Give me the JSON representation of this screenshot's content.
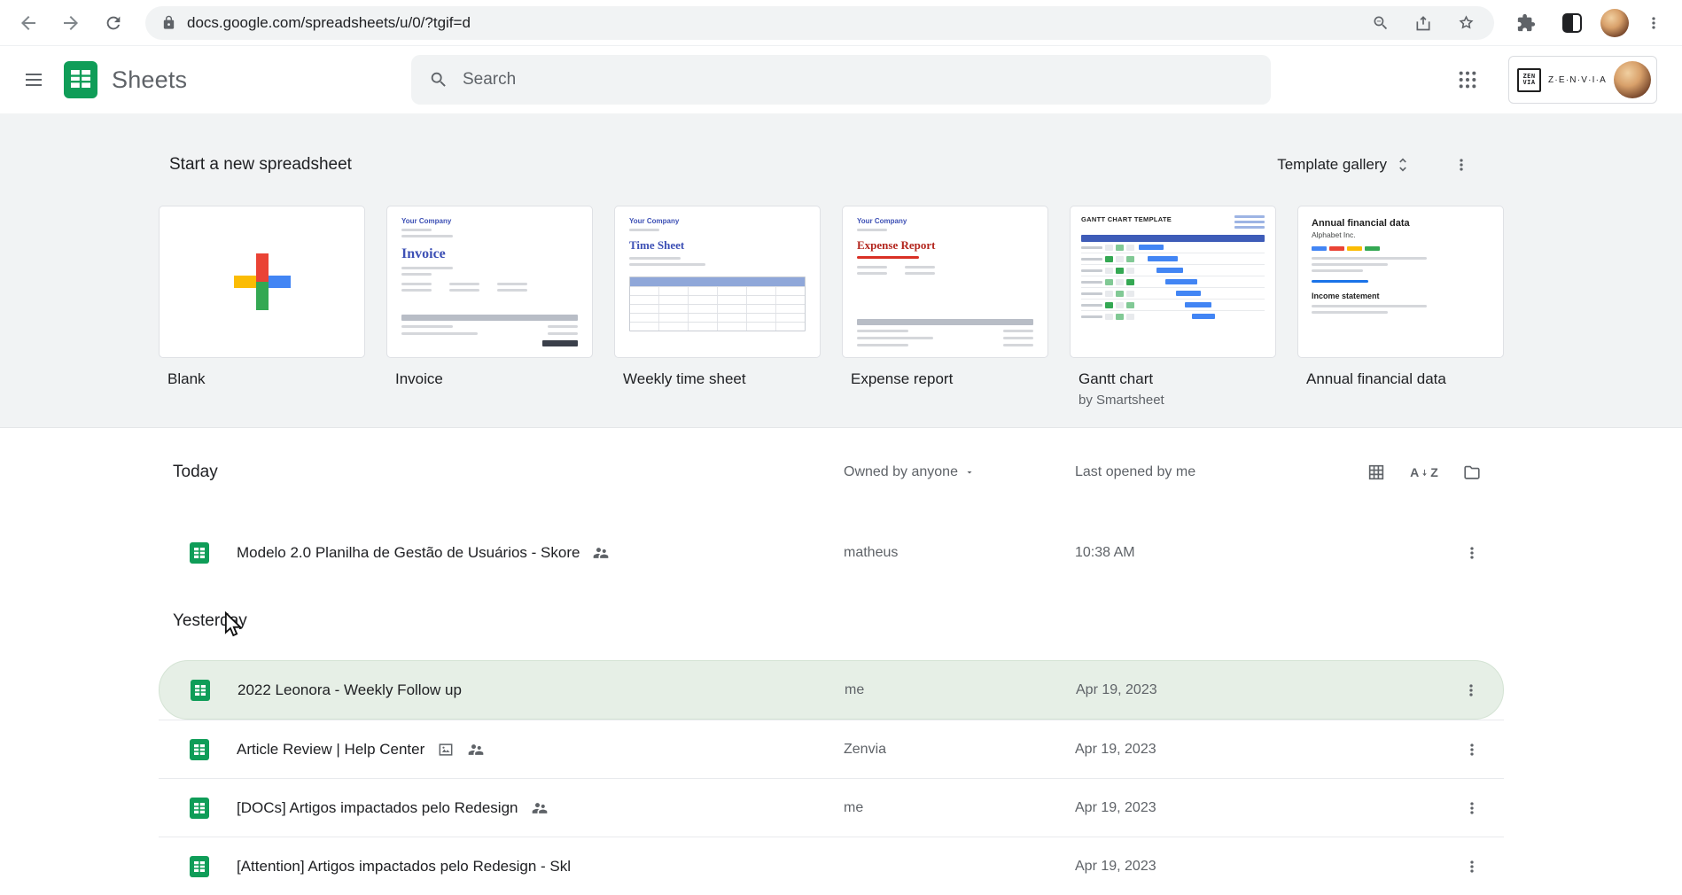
{
  "browser": {
    "url": "docs.google.com/spreadsheets/u/0/?tgif=d"
  },
  "app_header": {
    "title": "Sheets",
    "search_placeholder": "Search",
    "brand": {
      "logo_top": "ZEN",
      "logo_bottom": "VIA",
      "text": "Z·E·N·V·I·A"
    }
  },
  "icons": {
    "az_a": "A",
    "az_z": "Z"
  },
  "colors": {
    "sheets_green": "#0f9d58",
    "highlight_row": "#e6efe6"
  },
  "templates": {
    "heading": "Start a new spreadsheet",
    "gallery_label": "Template gallery",
    "cards": [
      {
        "label": "Blank"
      },
      {
        "label": "Invoice",
        "thumb": {
          "company": "Your Company",
          "title": "Invoice"
        }
      },
      {
        "label": "Weekly time sheet",
        "thumb": {
          "company": "Your Company",
          "title": "Time Sheet"
        }
      },
      {
        "label": "Expense report",
        "thumb": {
          "company": "Your Company",
          "title": "Expense Report"
        }
      },
      {
        "label": "Gantt chart",
        "sublabel": "by Smartsheet",
        "thumb": {
          "title": "GANTT CHART TEMPLATE"
        }
      },
      {
        "label": "Annual financial data",
        "thumb": {
          "title": "Annual financial data",
          "subtitle": "Alphabet Inc.",
          "footer": "Income statement"
        }
      }
    ]
  },
  "files": {
    "filter_label": "Owned by anyone",
    "last_opened_label": "Last opened by me",
    "groups": [
      {
        "heading": "Today",
        "rows": [
          {
            "name": "Modelo 2.0 Planilha de Gestão de Usuários - Skore",
            "owner": "matheus",
            "opened": "10:38 AM"
          }
        ]
      },
      {
        "heading": "Yesterday",
        "rows": [
          {
            "name": "2022 Leonora - Weekly Follow up",
            "owner": "me",
            "opened": "Apr 19, 2023"
          },
          {
            "name": "Article Review | Help Center",
            "owner": "Zenvia",
            "opened": "Apr 19, 2023"
          },
          {
            "name": "[DOCs] Artigos impactados pelo Redesign",
            "owner": "me",
            "opened": "Apr 19, 2023"
          },
          {
            "name": "[Attention] Artigos impactados pelo Redesign - Skl",
            "owner": "",
            "opened": "Apr 19, 2023"
          }
        ]
      }
    ]
  }
}
